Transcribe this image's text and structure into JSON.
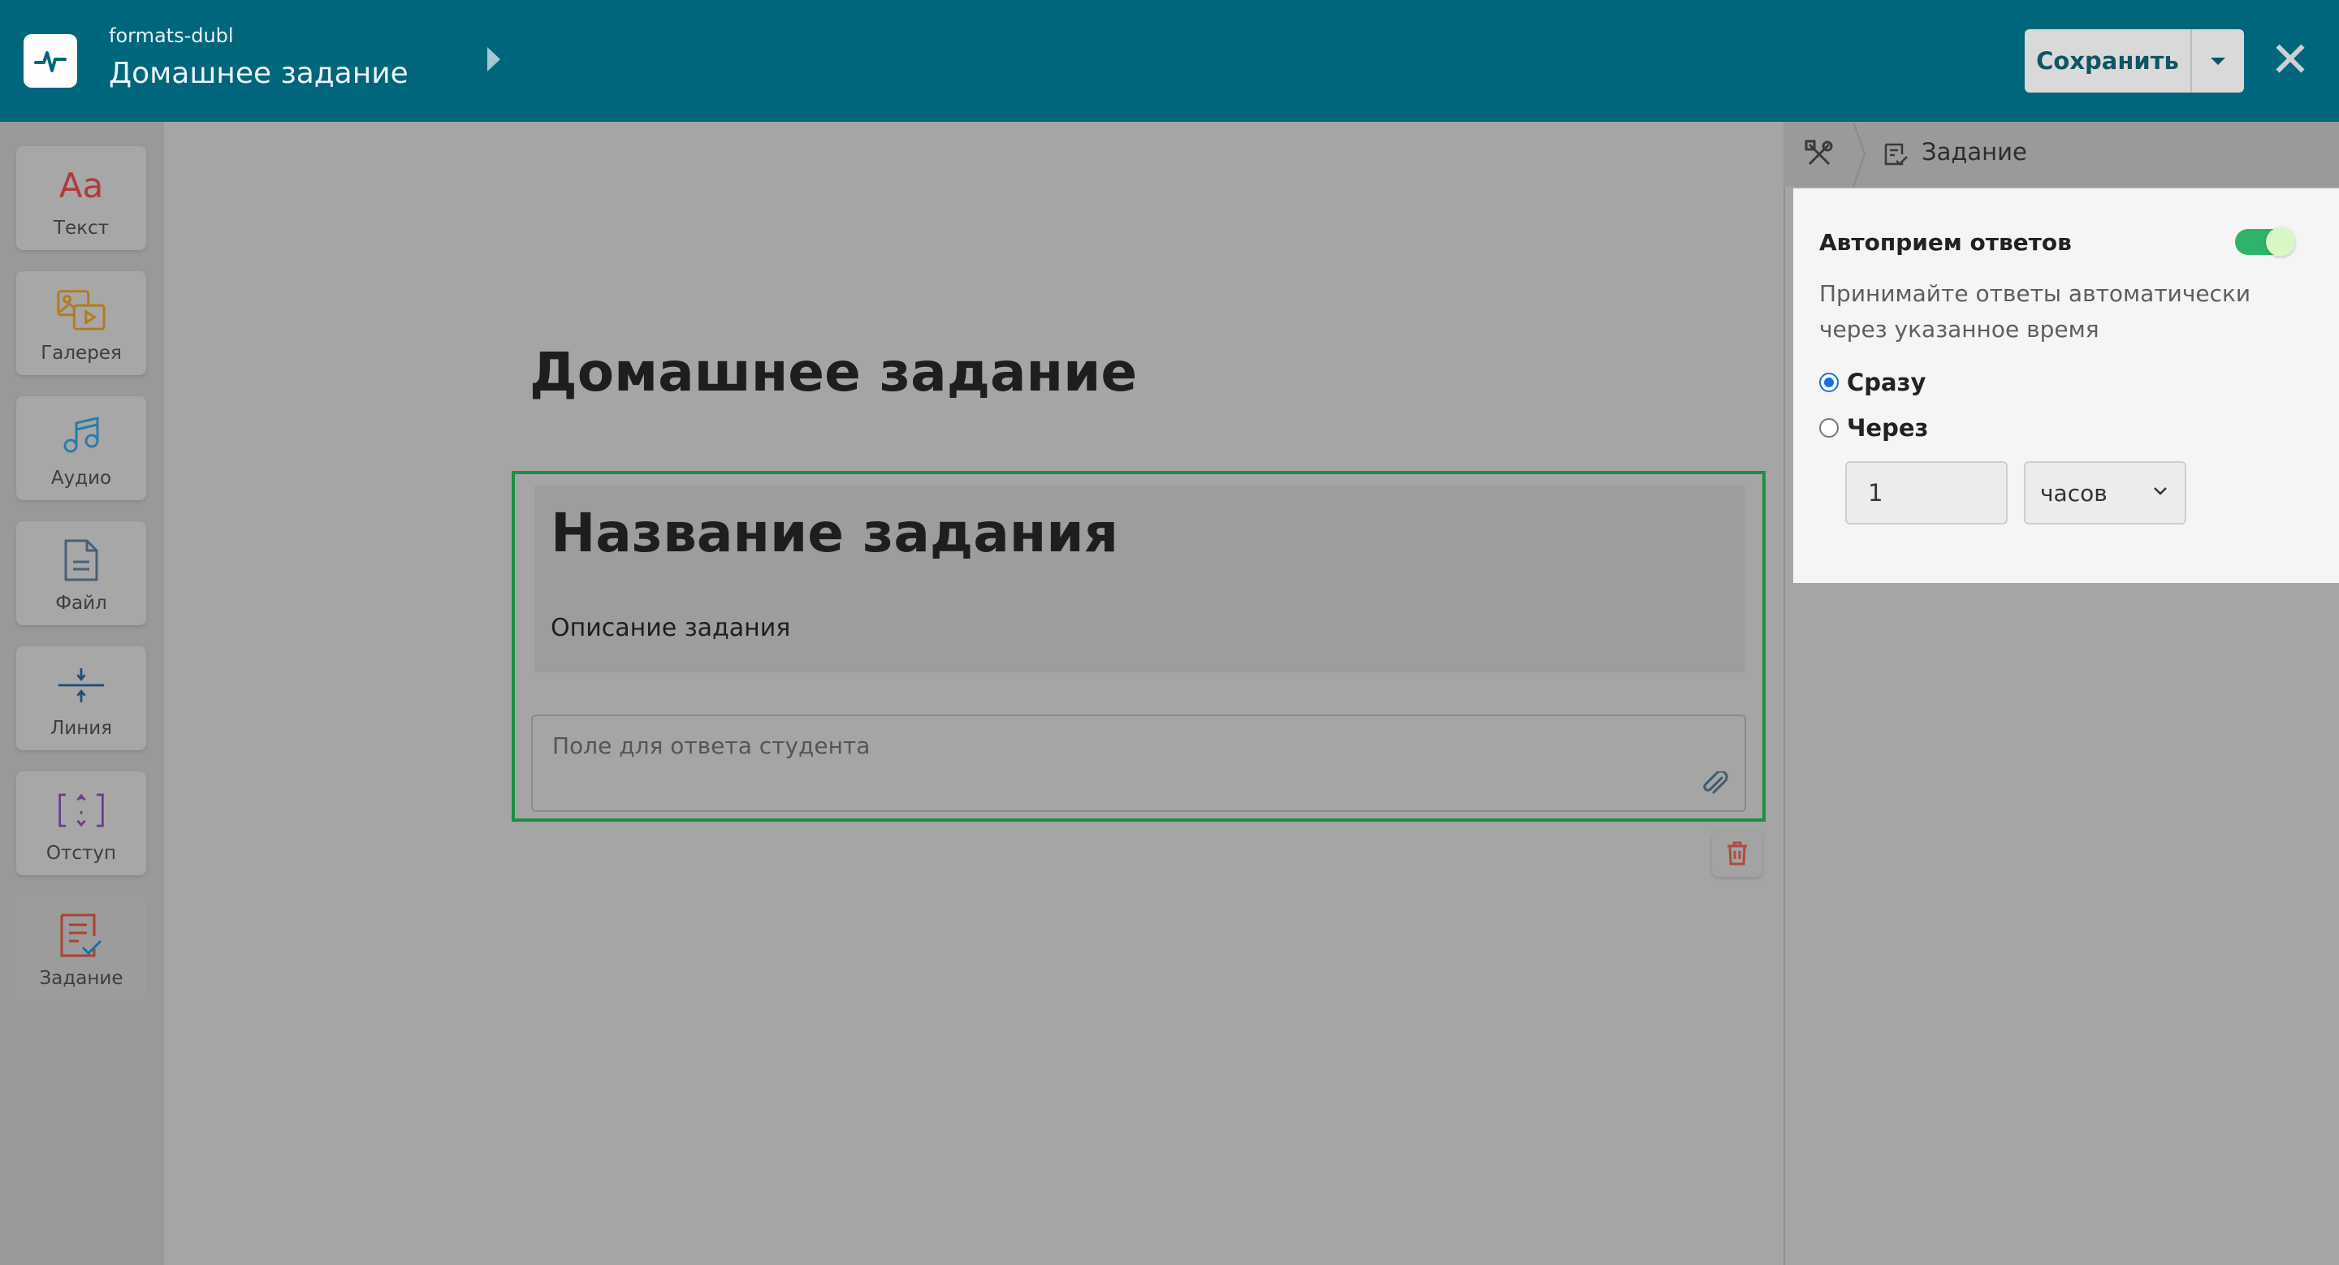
{
  "header": {
    "project": "formats-dubl",
    "title": "Домашнее задание",
    "save_label": "Сохранить",
    "close_symbol": "✕"
  },
  "toolbar": {
    "items": [
      {
        "label": "Текст",
        "icon": "text-aa-icon"
      },
      {
        "label": "Галерея",
        "icon": "gallery-icon"
      },
      {
        "label": "Аудио",
        "icon": "audio-note-icon"
      },
      {
        "label": "Файл",
        "icon": "file-icon"
      },
      {
        "label": "Линия",
        "icon": "line-icon"
      },
      {
        "label": "Отступ",
        "icon": "spacing-icon"
      },
      {
        "label": "Задание",
        "icon": "task-icon"
      }
    ],
    "text_icon_glyph": "Aa"
  },
  "canvas": {
    "doc_title": "Домашнее задание",
    "task_title": "Название задания",
    "task_description": "Описание задания",
    "answer_placeholder": "Поле для ответа студента"
  },
  "panel": {
    "breadcrumb": "Задание",
    "setting_title": "Автоприем ответов",
    "setting_enabled": true,
    "setting_description": "Принимайте ответы автоматически через указанное время",
    "option_immediately": "Сразу",
    "option_after": "Через",
    "selected_option": "Сразу",
    "delay_value": "1",
    "delay_unit": "часов"
  },
  "colors": {
    "header_bg": "#00667c",
    "accent_green": "#1b8f46",
    "toggle_on": "#2fb36b",
    "radio_blue": "#1a6fe0"
  }
}
